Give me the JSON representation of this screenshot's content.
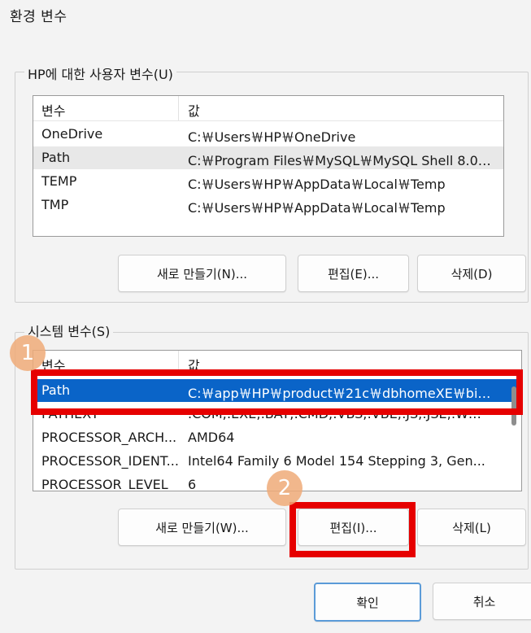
{
  "window": {
    "title": "환경 변수"
  },
  "user_vars": {
    "group_label": "HP에 대한 사용자 변수(U)",
    "headers": {
      "name": "변수",
      "value": "값"
    },
    "rows": [
      {
        "name": "OneDrive",
        "value": "C:￦Users￦HP￦OneDrive"
      },
      {
        "name": "Path",
        "value": "C:￦Program Files￦MySQL￦MySQL Shell 8.0￦..."
      },
      {
        "name": "TEMP",
        "value": "C:￦Users￦HP￦AppData￦Local￦Temp"
      },
      {
        "name": "TMP",
        "value": "C:￦Users￦HP￦AppData￦Local￦Temp"
      }
    ],
    "buttons": {
      "new": "새로 만들기(N)...",
      "edit": "편집(E)...",
      "delete": "삭제(D)"
    }
  },
  "system_vars": {
    "group_label": "시스템 변수(S)",
    "headers": {
      "name": "변수",
      "value": "값"
    },
    "rows": [
      {
        "name": "Path",
        "value": "C:￦app￦HP￦product￦21c￦dbhomeXE￦bin;..."
      },
      {
        "name": "PATHEXT",
        "value": ".COM;.EXE;.BAT;.CMD;.VBS;.VBE;.JS;.JSE;.WSF;..."
      },
      {
        "name": "PROCESSOR_ARCH...",
        "value": "AMD64"
      },
      {
        "name": "PROCESSOR_IDENT...",
        "value": "Intel64 Family 6 Model 154 Stepping 3, Gen..."
      },
      {
        "name": "PROCESSOR_LEVEL",
        "value": "6"
      }
    ],
    "buttons": {
      "new": "새로 만들기(W)...",
      "edit": "편집(I)...",
      "delete": "삭제(L)"
    }
  },
  "dialog_buttons": {
    "ok": "확인",
    "cancel": "취소"
  },
  "annotations": {
    "step1": "1",
    "step2": "2",
    "highlight_color": "#e60000",
    "badge_color": "#eeaa78"
  }
}
